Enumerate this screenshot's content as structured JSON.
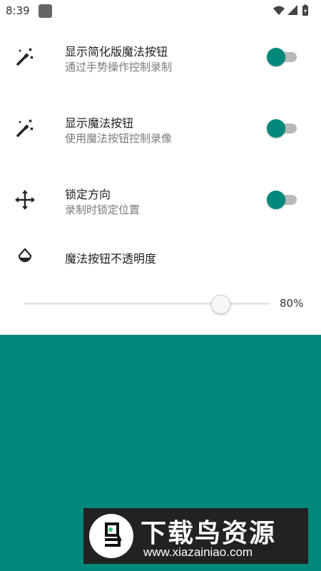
{
  "status_bar": {
    "time": "8:39",
    "icons": [
      "wifi-icon",
      "signal-icon",
      "battery-icon"
    ]
  },
  "settings": [
    {
      "icon": "magic-wand-icon",
      "title": "显示简化版魔法按钮",
      "subtitle": "通过手势操作控制录制",
      "enabled": true
    },
    {
      "icon": "magic-wand-icon",
      "title": "显示魔法按钮",
      "subtitle": "使用魔法按钮控制录像",
      "enabled": true
    },
    {
      "icon": "move-arrows-icon",
      "title": "锁定方向",
      "subtitle": "录制时锁定位置",
      "enabled": true
    }
  ],
  "opacity": {
    "icon": "opacity-drop-icon",
    "title": "魔法按钮不透明度",
    "value_label": "80%",
    "value": 0.8
  },
  "colors": {
    "accent": "#00897b",
    "track_off": "#b9b9b9"
  },
  "watermark": {
    "title": "下载鸟资源",
    "url": "www.xiazainiao.com"
  }
}
